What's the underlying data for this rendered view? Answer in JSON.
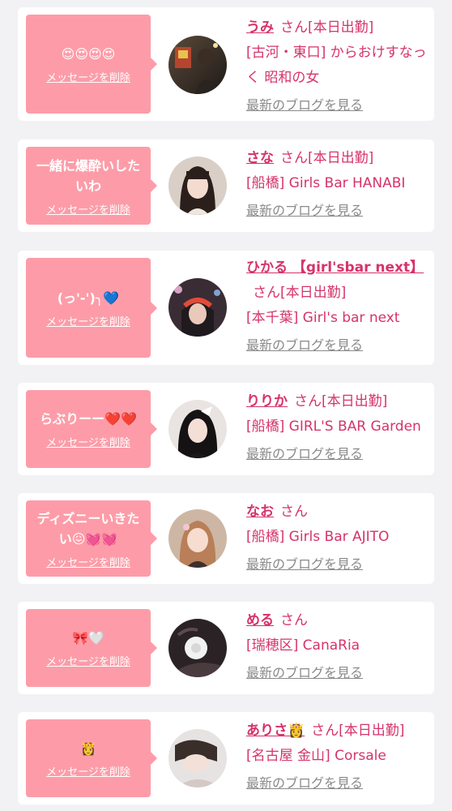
{
  "labels": {
    "delete": "メッセージを削除",
    "blog": "最新のブログを見る"
  },
  "colors": {
    "bubble": "#fd9ca8",
    "name": "#d6336c",
    "blog_link": "#8a8a8a",
    "background": "#f2f2f4"
  },
  "items": [
    {
      "message": "😍😍😍😍",
      "name": "うみ",
      "honorific": "さん",
      "status": "[本日出勤]",
      "shop": "[古河・東口] からおけすなっく 昭和の女",
      "avatar": "photo-avatar"
    },
    {
      "message": "一緒に爆酔いしたいわ",
      "name": "さな",
      "honorific": "さん",
      "status": "[本日出勤]",
      "shop": "[船橋] Girls Bar HANABI",
      "avatar": "photo-avatar"
    },
    {
      "message": "(っ'-')╮💙",
      "name": "ひかる 【girl'sbar next】",
      "honorific": "さん",
      "status": "[本日出勤]",
      "shop": "[本千葉] Girl's bar next",
      "avatar": "photo-avatar"
    },
    {
      "message": "らぶりーー❤️❤️",
      "name": "りりか",
      "honorific": "さん",
      "status": "[本日出勤]",
      "shop": "[船橋] GIRL'S BAR Garden",
      "avatar": "photo-avatar"
    },
    {
      "message": "ディズニーいきたい😖💓💓",
      "name": "なお",
      "honorific": "さん",
      "status": "",
      "shop": "[船橋] Girls Bar AJITO",
      "avatar": "photo-avatar"
    },
    {
      "message": "🎀🤍",
      "name": "める",
      "honorific": "さん",
      "status": "",
      "shop": "[瑞穂区] CanaRia",
      "avatar": "photo-avatar"
    },
    {
      "message": "👸",
      "name": "ありさ👸",
      "honorific": "さん",
      "status": "[本日出勤]",
      "shop": "[名古屋 金山] Corsale",
      "avatar": "photo-avatar"
    }
  ]
}
